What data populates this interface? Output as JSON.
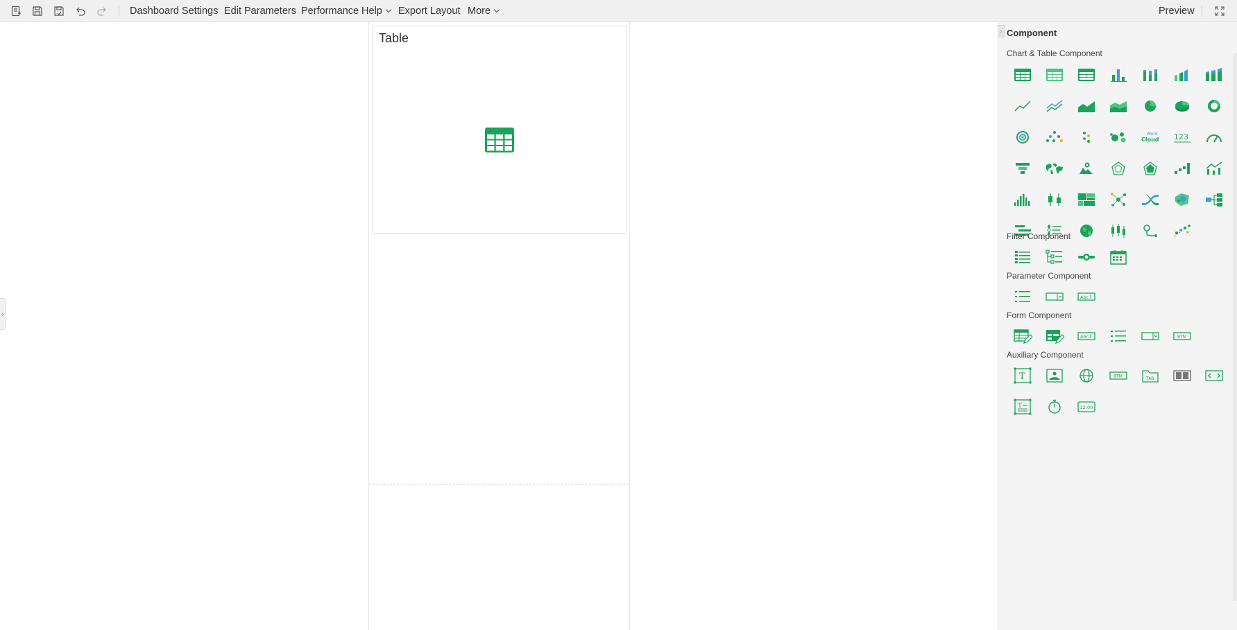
{
  "toolbar": {
    "icons": [
      "new-icon",
      "save-icon",
      "save-as-icon",
      "undo-icon",
      "redo-icon"
    ],
    "menus": {
      "dashboard_settings": "Dashboard Settings",
      "edit_parameters": "Edit Parameters",
      "performance_help": "Performance Help",
      "export_layout": "Export Layout",
      "more": "More"
    },
    "preview": "Preview",
    "fullscreen_icon": "fullscreen-icon"
  },
  "canvas": {
    "widget": {
      "title": "Table",
      "icon": "table-icon"
    },
    "left_handle_glyph": "›"
  },
  "panel": {
    "title": "Component",
    "collapse_glyph": "›",
    "sections": {
      "chart_table": {
        "title": "Chart & Table Component",
        "items": [
          "table",
          "crosstab",
          "grouped-table",
          "bar-chart",
          "stacked-bar",
          "3d-bar",
          "3d-stacked-bar",
          "line-chart",
          "multi-line",
          "area-chart",
          "stacked-area",
          "pie-chart",
          "3d-pie",
          "ring-chart",
          "rose-ring",
          "scatter",
          "small-scatter",
          "bubble",
          "word-cloud",
          "metric-number",
          "gauge",
          "funnel",
          "world-map",
          "geo-map",
          "radar",
          "filled-radar",
          "step-chart",
          "line-combo",
          "histogram",
          "box-plot",
          "treemap",
          "network",
          "sankey",
          "bubble-map",
          "tree-diagram",
          "gantt",
          "list-chart",
          "globe",
          "candlestick",
          "route-map",
          "flow-scatter"
        ],
        "word_cloud_text": [
          "Word",
          "Cloud"
        ],
        "metric_text": "123"
      },
      "filter": {
        "title": "Filter Component",
        "items": [
          "list-filter",
          "tree-filter",
          "range-slider",
          "calendar-filter"
        ]
      },
      "parameter": {
        "title": "Parameter Component",
        "items": [
          "param-list",
          "param-dropdown",
          "param-text"
        ]
      },
      "form": {
        "title": "Form Component",
        "items": [
          "edit-table",
          "edit-grid",
          "form-text",
          "form-list",
          "form-dropdown",
          "form-button"
        ]
      },
      "auxiliary": {
        "title": "Auxiliary Component",
        "items": [
          "text-box",
          "image",
          "web-page",
          "button",
          "tab",
          "carousel",
          "embed",
          "rich-text",
          "timer",
          "clock"
        ]
      },
      "glyphs": {
        "abc": "Abc",
        "btn": "BTN",
        "tab": "TAB",
        "time": "12:00",
        "text_t": "T"
      }
    }
  },
  "colors": {
    "accent": "#1aa35a",
    "accent_light": "#4fc583",
    "blue": "#3aa0d8",
    "orange": "#f5a623"
  }
}
